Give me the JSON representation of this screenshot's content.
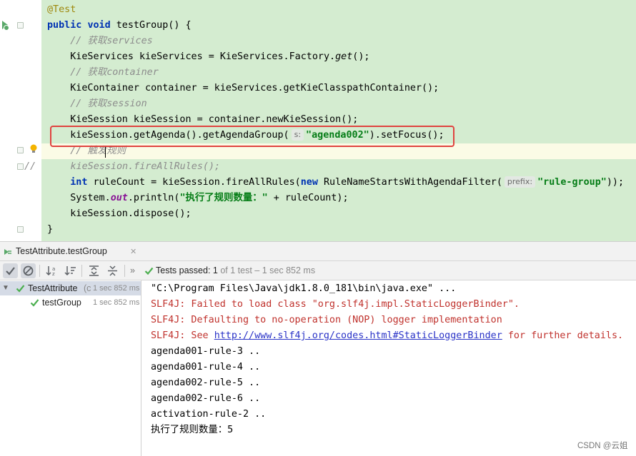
{
  "editor": {
    "lines": [
      {
        "segments": [
          {
            "t": "@Test",
            "c": "ann"
          }
        ]
      },
      {
        "segments": [
          {
            "t": "public ",
            "c": "kw"
          },
          {
            "t": "void ",
            "c": "kw"
          },
          {
            "t": "testGroup() {",
            "c": ""
          }
        ]
      },
      {
        "segments": [
          {
            "t": "    // 获取services",
            "c": "cm"
          }
        ]
      },
      {
        "segments": [
          {
            "t": "    KieServices kieServices = KieServices.Factory.",
            "c": ""
          },
          {
            "t": "get",
            "c": "fn"
          },
          {
            "t": "();",
            "c": ""
          }
        ]
      },
      {
        "segments": [
          {
            "t": "    // 获取container",
            "c": "cm"
          }
        ]
      },
      {
        "segments": [
          {
            "t": "    KieContainer container = kieServices.getKieClasspathContainer();",
            "c": ""
          }
        ]
      },
      {
        "segments": [
          {
            "t": "    // 获取session",
            "c": "cm"
          }
        ]
      },
      {
        "segments": [
          {
            "t": "    KieSession kieSession = container.newKieSession();",
            "c": ""
          }
        ]
      },
      {
        "segments": [
          {
            "t": "    kieSession.getAgenda().getAgendaGroup(",
            "c": ""
          },
          {
            "hint": "s:"
          },
          {
            "t": "\"agenda002\"",
            "c": "str"
          },
          {
            "t": ").setFocus();",
            "c": ""
          }
        ]
      },
      {
        "segments": [
          {
            "t": "    // 触发规则",
            "c": "cm"
          }
        ]
      },
      {
        "segments": [
          {
            "t": "//      kieSession.fireAllRules();",
            "c": "cm"
          }
        ]
      },
      {
        "segments": [
          {
            "t": "    ",
            "c": ""
          },
          {
            "t": "int ",
            "c": "kw"
          },
          {
            "t": "ruleCount = kieSession.fireAllRules(",
            "c": ""
          },
          {
            "t": "new ",
            "c": "kw"
          },
          {
            "t": "RuleNameStartsWithAgendaFilter(",
            "c": ""
          },
          {
            "hint": "prefix:"
          },
          {
            "t": "\"rule-group\"",
            "c": "str"
          },
          {
            "t": "));",
            "c": ""
          }
        ]
      },
      {
        "segments": [
          {
            "t": "    System.",
            "c": ""
          },
          {
            "t": "out",
            "c": "st"
          },
          {
            "t": ".println(",
            "c": ""
          },
          {
            "t": "\"执行了规则数量：\"",
            "c": "str"
          },
          {
            "t": " + ruleCount);",
            "c": ""
          }
        ]
      },
      {
        "segments": [
          {
            "t": "    kieSession.dispose();",
            "c": ""
          }
        ]
      },
      {
        "segments": [
          {
            "t": "}",
            "c": ""
          }
        ]
      }
    ]
  },
  "run_window": {
    "tab_label": "TestAttribute.testGroup",
    "status_label": "Tests passed:",
    "status_count": "1",
    "status_detail": "of 1 test – 1 sec 852 ms",
    "tree": [
      {
        "label": "TestAttribute",
        "suffix": "(c",
        "time": "1 sec 852 ms"
      },
      {
        "label": "testGroup",
        "suffix": "",
        "time": "1 sec 852 ms"
      }
    ]
  },
  "console": {
    "lines": [
      {
        "text": "\"C:\\Program Files\\Java\\jdk1.8.0_181\\bin\\java.exe\" ...",
        "type": "normal"
      },
      {
        "text": "SLF4J: Failed to load class \"org.slf4j.impl.StaticLoggerBinder\".",
        "type": "err"
      },
      {
        "text": "SLF4J: Defaulting to no-operation (NOP) logger implementation",
        "type": "err"
      },
      {
        "pre": "SLF4J: See ",
        "link": "http://www.slf4j.org/codes.html#StaticLoggerBinder",
        "post": " for further details.",
        "type": "err"
      },
      {
        "text": "agenda001-rule-3 ..",
        "type": "normal"
      },
      {
        "text": "agenda001-rule-4 ..",
        "type": "normal"
      },
      {
        "text": "agenda002-rule-5 ..",
        "type": "normal"
      },
      {
        "text": "agenda002-rule-6 ..",
        "type": "normal"
      },
      {
        "text": "activation-rule-2 ..",
        "type": "normal"
      },
      {
        "text": "执行了规则数量：5",
        "type": "normal"
      }
    ]
  },
  "watermark": "CSDN @云姐",
  "colors": {
    "highlight_box": "#e0433f",
    "code_bg": "#d4ecd0",
    "pass_green": "#4caf50",
    "error_red": "#c0322d"
  }
}
